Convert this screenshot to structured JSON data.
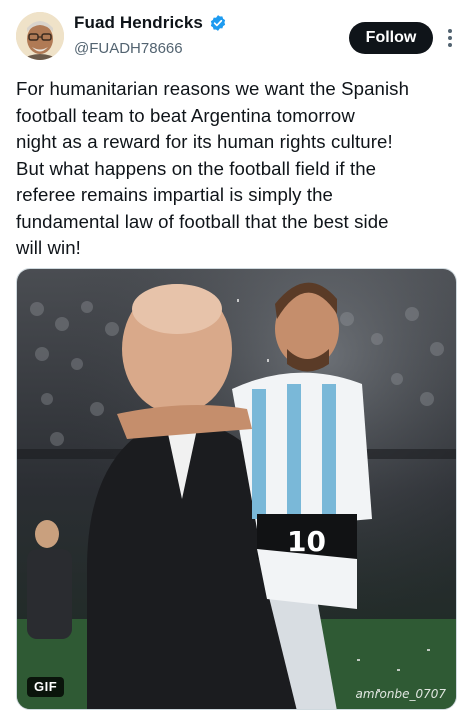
{
  "author": {
    "display_name": "Fuad Hendricks",
    "handle": "@FUADH78666",
    "verified_icon": "verified-badge-icon",
    "avatar_icon": "avatar"
  },
  "actions": {
    "follow_label": "Follow",
    "more_icon": "more-vertical-icon"
  },
  "tweet": {
    "text": "For humanitarian reasons we want the Spanish\nfootball team to beat Argentina tomorrow\nnight as a reward for its human rights culture!\nBut what happens on the football field if the\nreferee remains impartial is simply the\nfundamental law of football that the best side\nwill win!"
  },
  "media": {
    "type_badge": "GIF",
    "watermark": "amronbe_0707"
  },
  "colors": {
    "accent_verified": "#1d9bf0",
    "follow_bg": "#0f1419",
    "text_secondary": "#536471"
  }
}
